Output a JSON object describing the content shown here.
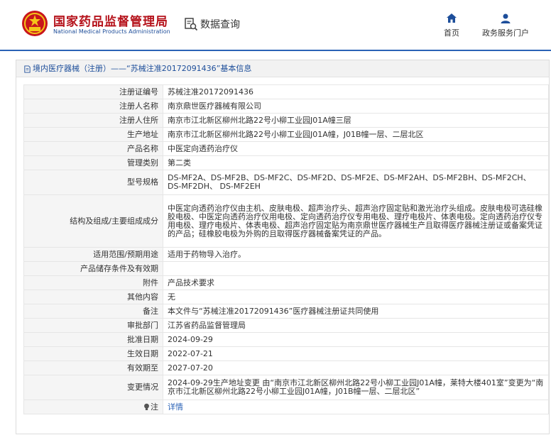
{
  "header": {
    "logo_cn": "国家药品监督管理局",
    "logo_en": "National Medical Products Administration",
    "search_title": "数据查询",
    "nav": [
      {
        "label": "首页",
        "icon": "home-icon"
      },
      {
        "label": "政务服务门户",
        "icon": "user-icon"
      }
    ],
    "accent_color": "#2a62b6",
    "brand_red": "#b5121b"
  },
  "breadcrumb": {
    "text": "境内医疗器械（注册）——“苏械注准20172091436”基本信息"
  },
  "rows": [
    {
      "key": "注册证编号",
      "value": "苏械注准20172091436"
    },
    {
      "key": "注册人名称",
      "value": "南京鼎世医疗器械有限公司"
    },
    {
      "key": "注册人住所",
      "value": "南京市江北新区柳州北路22号小柳工业园J01A幢三层"
    },
    {
      "key": "生产地址",
      "value": "南京市江北新区柳州北路22号小柳工业园J01A幢，J01B幢一层、二层北区"
    },
    {
      "key": "产品名称",
      "value": "中医定向透药治疗仪"
    },
    {
      "key": "管理类别",
      "value": "第二类"
    },
    {
      "key": "型号规格",
      "value": "DS-MF2A、DS-MF2B、DS-MF2C、DS-MF2D、DS-MF2E、DS-MF2AH、DS-MF2BH、DS-MF2CH、DS-MF2DH、 DS-MF2EH"
    },
    {
      "key": "结构及组成/主要组成成分",
      "value": "中医定向透药治疗仪由主机、皮肤电极、超声治疗头、超声治疗固定贴和激光治疗头组成。皮肤电极可选硅橡胶电极、中医定向透药治疗仪用电极、定向透药治疗仪专用电极、理疗电极片、体表电极。定向透药治疗仪专用电极、理疗电极片、体表电极、超声治疗固定贴为南京鼎世医疗器械生产且取得医疗器械注册证或备案凭证的产品；硅橡胶电极为外购的且取得医疗器械备案凭证的产品。"
    },
    {
      "key": "适用范围/预期用途",
      "value": "适用于药物导入治疗。"
    },
    {
      "key": "产品储存条件及有效期",
      "value": ""
    },
    {
      "key": "附件",
      "value": "产品技术要求"
    },
    {
      "key": "其他内容",
      "value": "无"
    },
    {
      "key": "备注",
      "value": "本文件与“苏械注准20172091436”医疗器械注册证共同使用"
    },
    {
      "key": "审批部门",
      "value": "江苏省药品监督管理局"
    },
    {
      "key": "批准日期",
      "value": "2024-09-29"
    },
    {
      "key": "生效日期",
      "value": "2022-07-21"
    },
    {
      "key": "有效期至",
      "value": "2027-07-20"
    },
    {
      "key": "变更情况",
      "value": "2024-09-29生产地址变更 由“南京市江北新区柳州北路22号小柳工业园J01A幢，莱特大楼401室”变更为“南京市江北新区柳州北路22号小柳工业园J01A幢，J01B幢一层、二层北区”"
    }
  ],
  "note_row": {
    "key": "注",
    "link_label": "详情"
  }
}
